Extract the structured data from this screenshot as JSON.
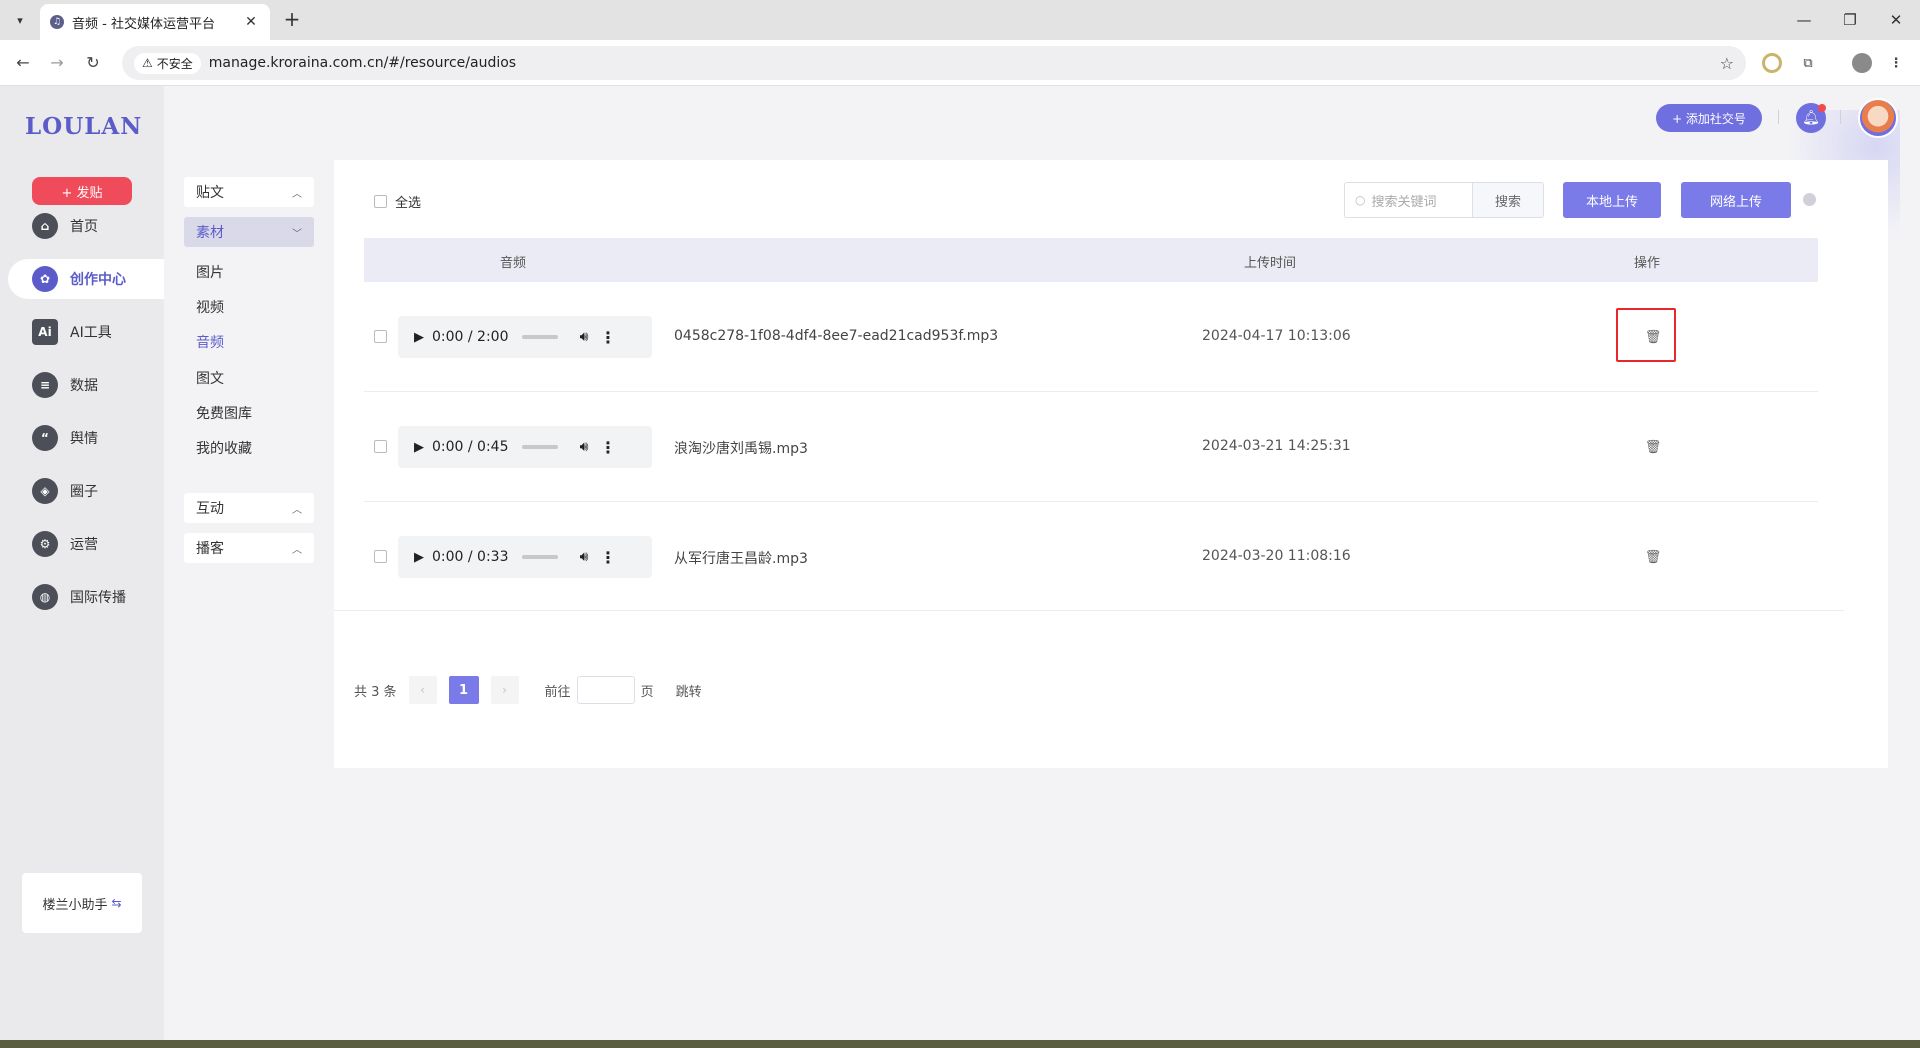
{
  "browser": {
    "tab_title": "音频 - 社交媒体运营平台",
    "new_tab": "+",
    "insecure_label": "不安全",
    "url": "manage.kroraina.com.cn/#/resource/audios"
  },
  "sidebar": {
    "logo": "LOULAN",
    "post_button": "+ 发贴",
    "items": [
      {
        "label": "首页",
        "icon": "home-icon",
        "glyph": "⌂"
      },
      {
        "label": "创作中心",
        "icon": "palette-icon",
        "glyph": "✿"
      },
      {
        "label": "AI工具",
        "icon": "ai-icon",
        "glyph": "Ai"
      },
      {
        "label": "数据",
        "icon": "database-icon",
        "glyph": "≡"
      },
      {
        "label": "舆情",
        "icon": "quote-icon",
        "glyph": "“"
      },
      {
        "label": "圈子",
        "icon": "compass-icon",
        "glyph": "◈"
      },
      {
        "label": "运营",
        "icon": "operations-icon",
        "glyph": "⚙"
      },
      {
        "label": "国际传播",
        "icon": "globe-icon",
        "glyph": "◍"
      }
    ],
    "assistant_label": "楼兰小助手",
    "assistant_icon": "⇆"
  },
  "header": {
    "add_social": "+ 添加社交号"
  },
  "submenu": {
    "groups": [
      {
        "label": "贴文"
      },
      {
        "label": "素材"
      },
      {
        "label": "互动"
      },
      {
        "label": "播客"
      }
    ],
    "material_items": [
      "图片",
      "视频",
      "音频",
      "图文",
      "免费图库",
      "我的收藏"
    ]
  },
  "toolbar": {
    "select_all": "全选",
    "search_placeholder": "搜索关键词",
    "search_button": "搜索",
    "local_upload": "本地上传",
    "web_upload": "网络上传"
  },
  "table": {
    "headers": {
      "audio": "音频",
      "upload_time": "上传时间",
      "actions": "操作"
    },
    "rows": [
      {
        "player_time": "0:00 / 2:00",
        "filename": "0458c278-1f08-4df4-8ee7-ead21cad953f.mp3",
        "uploaded": "2024-04-17 10:13:06"
      },
      {
        "player_time": "0:00 / 0:45",
        "filename": "浪淘沙唐刘禹锡.mp3",
        "uploaded": "2024-03-21 14:25:31"
      },
      {
        "player_time": "0:00 / 0:33",
        "filename": "从军行唐王昌龄.mp3",
        "uploaded": "2024-03-20 11:08:16"
      }
    ]
  },
  "pager": {
    "total": "共 3 条",
    "current": "1",
    "goto_prefix": "前往",
    "goto_suffix": "页",
    "jump": "跳转"
  }
}
